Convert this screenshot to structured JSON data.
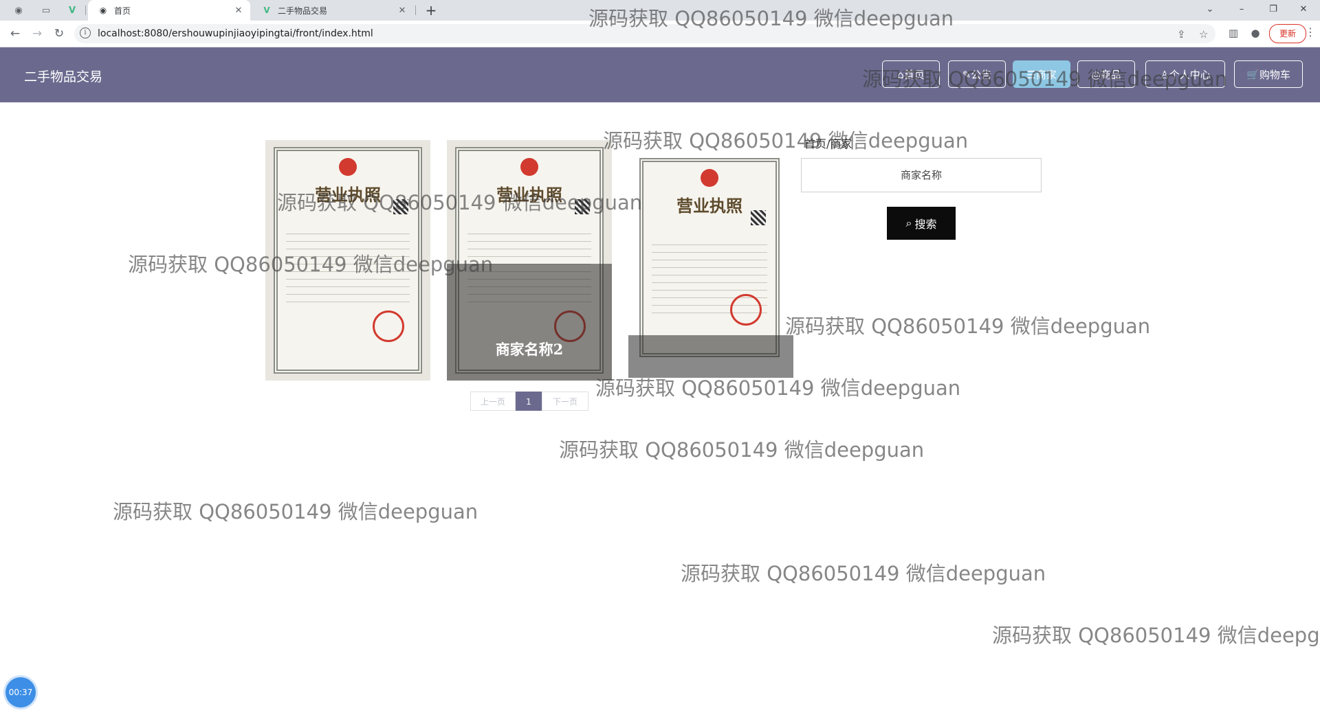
{
  "browser": {
    "tabs": [
      {
        "title": "首页",
        "active": true
      },
      {
        "title": "二手物品交易",
        "active": false
      }
    ],
    "address": "localhost:8080/ershouwupinjiaoyipingtai/front/index.html",
    "update_label": "更新"
  },
  "site": {
    "title": "二手物品交易",
    "nav": [
      {
        "label": "首页"
      },
      {
        "label": "公告"
      },
      {
        "label": "商家"
      },
      {
        "label": "商品"
      },
      {
        "label": "个人中心"
      },
      {
        "label": "购物车"
      }
    ]
  },
  "merchants": {
    "cards": [
      {
        "caption": ""
      },
      {
        "caption": "商家名称2"
      },
      {
        "caption": ""
      }
    ],
    "license_text": "营业执照"
  },
  "pagination": {
    "prev": "上一页",
    "current": "1",
    "next": "下一页"
  },
  "search": {
    "breadcrumb": "首页/商家",
    "placeholder": "商家名称",
    "button_label": "搜索"
  },
  "watermark_text": "源码获取 QQ86050149 微信deepguan",
  "recording": {
    "timer": "00:37"
  },
  "colors": {
    "header": "#6b6a8e",
    "active_nav": "#8ec7e4",
    "search_button": "#0c0c0c"
  }
}
